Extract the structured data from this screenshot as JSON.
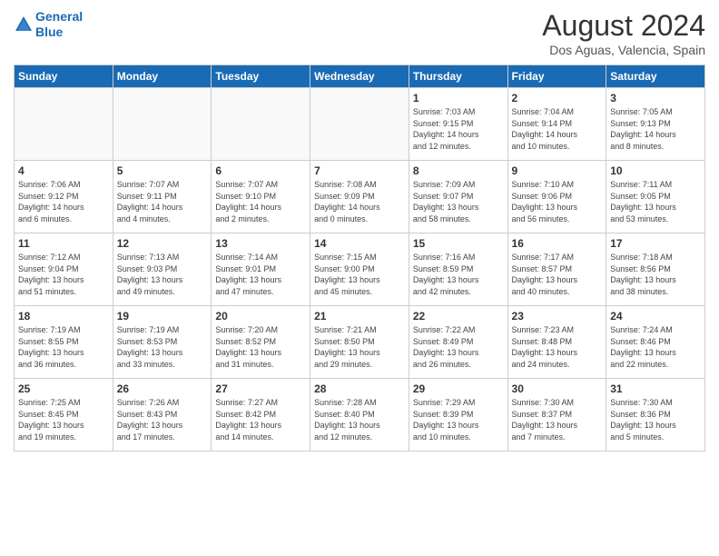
{
  "header": {
    "logo_line1": "General",
    "logo_line2": "Blue",
    "month_year": "August 2024",
    "location": "Dos Aguas, Valencia, Spain"
  },
  "days_of_week": [
    "Sunday",
    "Monday",
    "Tuesday",
    "Wednesday",
    "Thursday",
    "Friday",
    "Saturday"
  ],
  "weeks": [
    [
      {
        "day": "",
        "info": ""
      },
      {
        "day": "",
        "info": ""
      },
      {
        "day": "",
        "info": ""
      },
      {
        "day": "",
        "info": ""
      },
      {
        "day": "1",
        "info": "Sunrise: 7:03 AM\nSunset: 9:15 PM\nDaylight: 14 hours\nand 12 minutes."
      },
      {
        "day": "2",
        "info": "Sunrise: 7:04 AM\nSunset: 9:14 PM\nDaylight: 14 hours\nand 10 minutes."
      },
      {
        "day": "3",
        "info": "Sunrise: 7:05 AM\nSunset: 9:13 PM\nDaylight: 14 hours\nand 8 minutes."
      }
    ],
    [
      {
        "day": "4",
        "info": "Sunrise: 7:06 AM\nSunset: 9:12 PM\nDaylight: 14 hours\nand 6 minutes."
      },
      {
        "day": "5",
        "info": "Sunrise: 7:07 AM\nSunset: 9:11 PM\nDaylight: 14 hours\nand 4 minutes."
      },
      {
        "day": "6",
        "info": "Sunrise: 7:07 AM\nSunset: 9:10 PM\nDaylight: 14 hours\nand 2 minutes."
      },
      {
        "day": "7",
        "info": "Sunrise: 7:08 AM\nSunset: 9:09 PM\nDaylight: 14 hours\nand 0 minutes."
      },
      {
        "day": "8",
        "info": "Sunrise: 7:09 AM\nSunset: 9:07 PM\nDaylight: 13 hours\nand 58 minutes."
      },
      {
        "day": "9",
        "info": "Sunrise: 7:10 AM\nSunset: 9:06 PM\nDaylight: 13 hours\nand 56 minutes."
      },
      {
        "day": "10",
        "info": "Sunrise: 7:11 AM\nSunset: 9:05 PM\nDaylight: 13 hours\nand 53 minutes."
      }
    ],
    [
      {
        "day": "11",
        "info": "Sunrise: 7:12 AM\nSunset: 9:04 PM\nDaylight: 13 hours\nand 51 minutes."
      },
      {
        "day": "12",
        "info": "Sunrise: 7:13 AM\nSunset: 9:03 PM\nDaylight: 13 hours\nand 49 minutes."
      },
      {
        "day": "13",
        "info": "Sunrise: 7:14 AM\nSunset: 9:01 PM\nDaylight: 13 hours\nand 47 minutes."
      },
      {
        "day": "14",
        "info": "Sunrise: 7:15 AM\nSunset: 9:00 PM\nDaylight: 13 hours\nand 45 minutes."
      },
      {
        "day": "15",
        "info": "Sunrise: 7:16 AM\nSunset: 8:59 PM\nDaylight: 13 hours\nand 42 minutes."
      },
      {
        "day": "16",
        "info": "Sunrise: 7:17 AM\nSunset: 8:57 PM\nDaylight: 13 hours\nand 40 minutes."
      },
      {
        "day": "17",
        "info": "Sunrise: 7:18 AM\nSunset: 8:56 PM\nDaylight: 13 hours\nand 38 minutes."
      }
    ],
    [
      {
        "day": "18",
        "info": "Sunrise: 7:19 AM\nSunset: 8:55 PM\nDaylight: 13 hours\nand 36 minutes."
      },
      {
        "day": "19",
        "info": "Sunrise: 7:19 AM\nSunset: 8:53 PM\nDaylight: 13 hours\nand 33 minutes."
      },
      {
        "day": "20",
        "info": "Sunrise: 7:20 AM\nSunset: 8:52 PM\nDaylight: 13 hours\nand 31 minutes."
      },
      {
        "day": "21",
        "info": "Sunrise: 7:21 AM\nSunset: 8:50 PM\nDaylight: 13 hours\nand 29 minutes."
      },
      {
        "day": "22",
        "info": "Sunrise: 7:22 AM\nSunset: 8:49 PM\nDaylight: 13 hours\nand 26 minutes."
      },
      {
        "day": "23",
        "info": "Sunrise: 7:23 AM\nSunset: 8:48 PM\nDaylight: 13 hours\nand 24 minutes."
      },
      {
        "day": "24",
        "info": "Sunrise: 7:24 AM\nSunset: 8:46 PM\nDaylight: 13 hours\nand 22 minutes."
      }
    ],
    [
      {
        "day": "25",
        "info": "Sunrise: 7:25 AM\nSunset: 8:45 PM\nDaylight: 13 hours\nand 19 minutes."
      },
      {
        "day": "26",
        "info": "Sunrise: 7:26 AM\nSunset: 8:43 PM\nDaylight: 13 hours\nand 17 minutes."
      },
      {
        "day": "27",
        "info": "Sunrise: 7:27 AM\nSunset: 8:42 PM\nDaylight: 13 hours\nand 14 minutes."
      },
      {
        "day": "28",
        "info": "Sunrise: 7:28 AM\nSunset: 8:40 PM\nDaylight: 13 hours\nand 12 minutes."
      },
      {
        "day": "29",
        "info": "Sunrise: 7:29 AM\nSunset: 8:39 PM\nDaylight: 13 hours\nand 10 minutes."
      },
      {
        "day": "30",
        "info": "Sunrise: 7:30 AM\nSunset: 8:37 PM\nDaylight: 13 hours\nand 7 minutes."
      },
      {
        "day": "31",
        "info": "Sunrise: 7:30 AM\nSunset: 8:36 PM\nDaylight: 13 hours\nand 5 minutes."
      }
    ]
  ]
}
